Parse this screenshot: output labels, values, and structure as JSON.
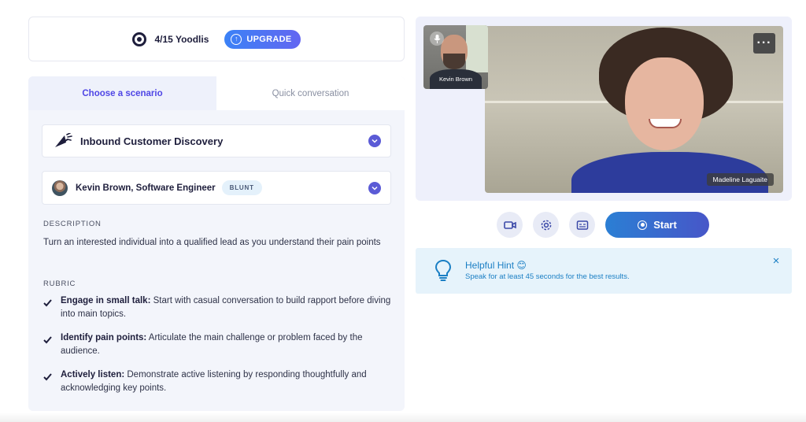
{
  "usage": {
    "count_label": "4/15 Yoodlis",
    "upgrade_label": "UPGRADE"
  },
  "tabs": [
    {
      "label": "Choose a scenario",
      "active": true
    },
    {
      "label": "Quick conversation",
      "active": false
    }
  ],
  "scenario": {
    "label": "Inbound Customer Discovery",
    "icon": "megaphone-icon"
  },
  "persona": {
    "label": "Kevin Brown, Software Engineer",
    "badge": "BLUNT"
  },
  "description": {
    "title": "DESCRIPTION",
    "text": "Turn an interested individual into a qualified lead as you understand their pain points"
  },
  "rubric": {
    "title": "RUBRIC",
    "items": [
      {
        "bold": "Engage in small talk:",
        "text": " Start with casual conversation to build rapport before diving into main topics."
      },
      {
        "bold": "Identify pain points:",
        "text": " Articulate the main challenge or problem faced by the audience."
      },
      {
        "bold": "Actively listen:",
        "text": " Demonstrate active listening by responding thoughtfully and acknowledging key points."
      }
    ]
  },
  "video": {
    "thumbnail_name": "Kevin Brown",
    "main_name": "Madeline Laguaite",
    "more_label": "···"
  },
  "controls": {
    "start_label": "Start",
    "icons": [
      "video-camera-icon",
      "gear-icon",
      "captions-icon"
    ]
  },
  "hint": {
    "title": "Helpful Hint 😊",
    "text": "Speak for at least 45 seconds for the best results.",
    "close_label": "×"
  },
  "colors": {
    "accent": "#4f46e5",
    "chevron": "#5b5bd6",
    "hint": "#1b7fc4",
    "panel_bg": "#f3f5fb"
  }
}
